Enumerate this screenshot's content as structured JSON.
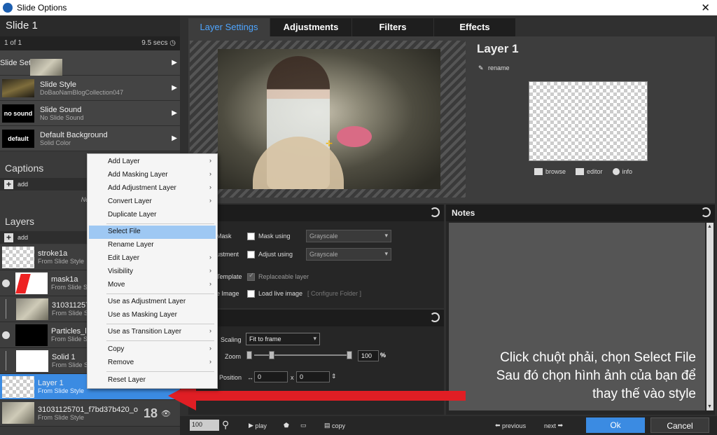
{
  "window": {
    "title": "Slide Options"
  },
  "left": {
    "slide_name": "Slide 1",
    "slide_count": "1 of 1",
    "duration": "9.5 secs",
    "menu": [
      {
        "title": "Slide Settings",
        "sub": ""
      },
      {
        "title": "Slide Style",
        "sub": "DoBaoNamBlogCollection047"
      },
      {
        "title": "Slide Sound",
        "sub": "No Slide Sound",
        "thumb": "no sound"
      },
      {
        "title": "Default Background",
        "sub": "Solid Color",
        "thumb": "default"
      }
    ],
    "captions": {
      "title": "Captions",
      "add": "add",
      "empty": "No Ca"
    },
    "layers": {
      "title": "Layers",
      "add": "add",
      "items": [
        {
          "name": "stroke1a",
          "sub": "From Slide Style"
        },
        {
          "name": "mask1a",
          "sub": "From Slide Sty"
        },
        {
          "name": "3103112570",
          "sub": "From Slide Sty"
        },
        {
          "name": "Particles_li",
          "sub": "From Slide Sty"
        },
        {
          "name": "Solid 1",
          "sub": "From Slide Sty"
        },
        {
          "name": "Layer 1",
          "sub": "From Slide Style"
        },
        {
          "name": "31031125701_f7bd37b420_o",
          "sub": "From Slide Style"
        }
      ],
      "count_badge": "18"
    }
  },
  "tabs": [
    "Layer Settings",
    "Adjustments",
    "Filters",
    "Effects"
  ],
  "layer_settings": {
    "title": "Layer 1",
    "rename": "rename",
    "actions": [
      "browse",
      "editor",
      "info"
    ]
  },
  "type_panel": {
    "title": "ype",
    "rows": [
      {
        "label": "Mask",
        "check_label": "Mask using",
        "value": "Grayscale"
      },
      {
        "label": "ustment",
        "check_label": "Adjust using",
        "value": "Grayscale"
      },
      {
        "label": "Template",
        "check_label": "Replaceable layer"
      },
      {
        "label": "e Image",
        "check_label": "Load live image",
        "extra": "[ Configure Folder ]"
      }
    ]
  },
  "setup_panel": {
    "title": "etup",
    "scaling_label": "Scaling",
    "scaling_value": "Fit to frame",
    "zoom_label": "Zoom",
    "zoom_value": "100",
    "zoom_unit": "%",
    "zoom_level": 0.19,
    "position_label": "Position",
    "pos_x": "0",
    "pos_sep": "x",
    "pos_y": "0"
  },
  "notes": {
    "title": "Notes",
    "overlay_lines": [
      "Click chuột phải, chọn Select File",
      "Sau đó chọn hình ảnh của bạn để",
      "thay thế vào style"
    ]
  },
  "bottom": {
    "zoom": "100",
    "play": "play",
    "copy": "copy",
    "previous": "previous",
    "next": "next",
    "ok": "Ok",
    "cancel": "Cancel"
  },
  "context_menu": {
    "items": [
      {
        "label": "Add Layer",
        "sub": true
      },
      {
        "label": "Add Masking Layer",
        "sub": true
      },
      {
        "label": "Add Adjustment Layer",
        "sub": true
      },
      {
        "label": "Convert Layer",
        "sub": true
      },
      {
        "label": "Duplicate Layer",
        "sub": false
      },
      {
        "label": "Select File",
        "sub": false,
        "highlight": true
      },
      {
        "label": "Rename Layer",
        "sub": false
      },
      {
        "label": "Edit Layer",
        "sub": true
      },
      {
        "label": "Visibility",
        "sub": true
      },
      {
        "label": "Move",
        "sub": true
      },
      {
        "label": "Use as Adjustment Layer",
        "sub": false
      },
      {
        "label": "Use as Masking Layer",
        "sub": false
      },
      {
        "label": "Use as Transition Layer",
        "sub": true
      },
      {
        "label": "Copy",
        "sub": true
      },
      {
        "label": "Remove",
        "sub": true
      },
      {
        "label": "Reset Layer",
        "sub": false
      }
    ]
  },
  "colors": {
    "accent": "#3b8be2",
    "tab_active": "#4ea5ff",
    "annotation": "#e01e24"
  }
}
